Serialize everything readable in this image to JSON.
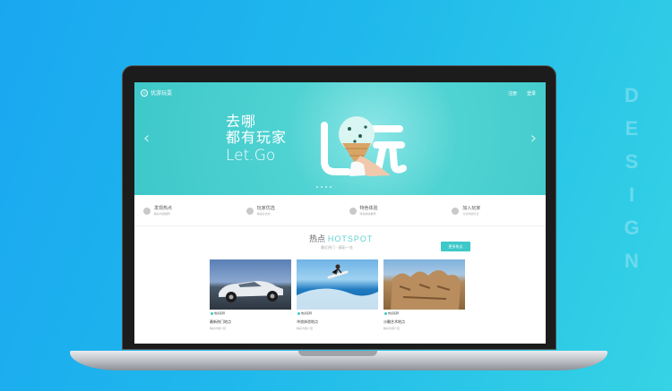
{
  "design": [
    "D",
    "E",
    "S",
    "I",
    "G",
    "N"
  ],
  "site": {
    "name": "优游玩耍"
  },
  "nav": {
    "register": "注册",
    "login": "登录"
  },
  "hero": {
    "line1": "去哪",
    "line2": "都有玩家",
    "line3": "Let.Go",
    "badge": "玩"
  },
  "features": [
    {
      "title": "发现热点",
      "desc": "精彩内容推荐"
    },
    {
      "title": "玩家优选",
      "desc": "精选好去处"
    },
    {
      "title": "特色体验",
      "desc": "特色体验推荐"
    },
    {
      "title": "加入玩家",
      "desc": "分享你的玩法"
    }
  ],
  "section": {
    "title_cn": "热点",
    "title_en": "HOTSPOT",
    "subtitle": "最近热门 · 精彩一览",
    "more": "更多热点"
  },
  "cards": [
    {
      "caption": "地点名称",
      "title": "最新热门地点",
      "desc": "精彩内容介绍"
    },
    {
      "caption": "地点名称",
      "title": "冲浪体验地点",
      "desc": "精彩内容介绍"
    },
    {
      "caption": "地点名称",
      "title": "沙雕艺术地点",
      "desc": "精彩内容介绍"
    }
  ],
  "colors": {
    "accent": "#3ec8c9",
    "background": "#1aa7f0"
  }
}
